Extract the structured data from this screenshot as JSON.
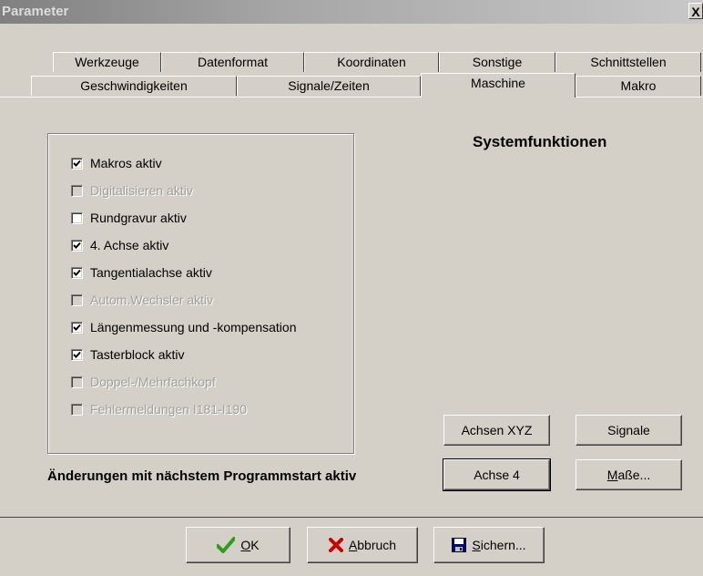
{
  "window": {
    "title": "Parameter",
    "close_label": "X"
  },
  "tabs_top": [
    "Werkzeuge",
    "Datenformat",
    "Koordinaten",
    "Sonstige",
    "Schnittstellen"
  ],
  "tabs_bottom": [
    "Geschwindigkeiten",
    "Signale/Zeiten",
    "Maschine",
    "Makro"
  ],
  "active_tab": "Maschine",
  "options": [
    {
      "label": "Makros aktiv",
      "checked": true,
      "enabled": true
    },
    {
      "label": "Digitalisieren aktiv",
      "checked": false,
      "enabled": false
    },
    {
      "label": "Rundgravur aktiv",
      "checked": false,
      "enabled": true
    },
    {
      "label": "4. Achse aktiv",
      "checked": true,
      "enabled": true
    },
    {
      "label": "Tangentialachse aktiv",
      "checked": true,
      "enabled": true
    },
    {
      "label": "Autom.Wechsler aktiv",
      "checked": false,
      "enabled": false
    },
    {
      "label": "Längenmessung und -kompensation",
      "checked": true,
      "enabled": true
    },
    {
      "label": "Tasterblock aktiv",
      "checked": true,
      "enabled": true
    },
    {
      "label": "Doppel-/Mehrfachkopf",
      "checked": false,
      "enabled": false
    },
    {
      "label": "Fehlermeldungen I181-I190",
      "checked": false,
      "enabled": false
    }
  ],
  "system": {
    "heading": "Systemfunktionen",
    "achsen_xyz": "Achsen XYZ",
    "signale": "Signale",
    "achse4": "Achse 4",
    "masse_underlined": "M",
    "masse_rest": "aße..."
  },
  "note": "Änderungen mit nächstem Programmstart aktiv",
  "footer": {
    "ok_u": "O",
    "ok_rest": "K",
    "abbruch_u": "A",
    "abbruch_rest": "bbruch",
    "sichern_u": "S",
    "sichern_rest": "ichern..."
  },
  "colors": {
    "check_ok": "#2e9e1a",
    "cancel_x": "#cc0000",
    "dialog_bg": "#d4d0c8"
  },
  "icons": {
    "ok": "checkmark-icon",
    "abbruch": "red-x-icon",
    "sichern": "floppy-disk-icon"
  }
}
